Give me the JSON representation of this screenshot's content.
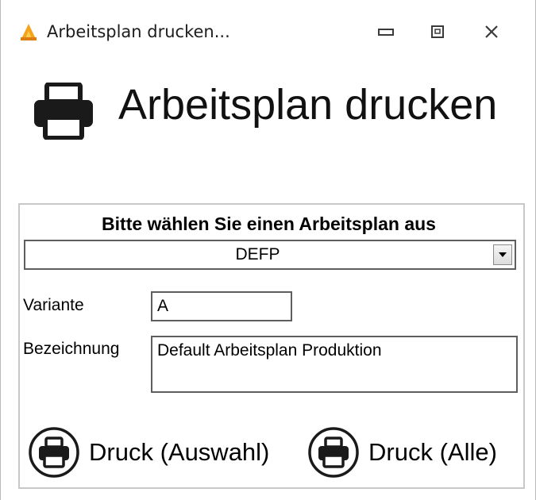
{
  "window": {
    "title": "Arbeitsplan drucken...",
    "icon": "app-flame-icon",
    "controls": [
      "minimize-icon",
      "maximize-icon",
      "close-icon"
    ]
  },
  "header": {
    "icon": "printer-icon",
    "title": "Arbeitsplan drucken"
  },
  "form": {
    "prompt": "Bitte wählen Sie einen Arbeitsplan aus",
    "plan_select": {
      "value": "DEFP"
    },
    "variante_label": "Variante",
    "variante_value": "A",
    "bezeichnung_label": "Bezeichnung",
    "bezeichnung_value": "Default Arbeitsplan Produktion"
  },
  "actions": {
    "print_selection_label": "Druck (Auswahl)",
    "print_all_label": "Druck (Alle)"
  },
  "colors": {
    "border": "#c8c8c8",
    "field_border": "#5e5e5e",
    "icon": "#1a1a1a"
  }
}
